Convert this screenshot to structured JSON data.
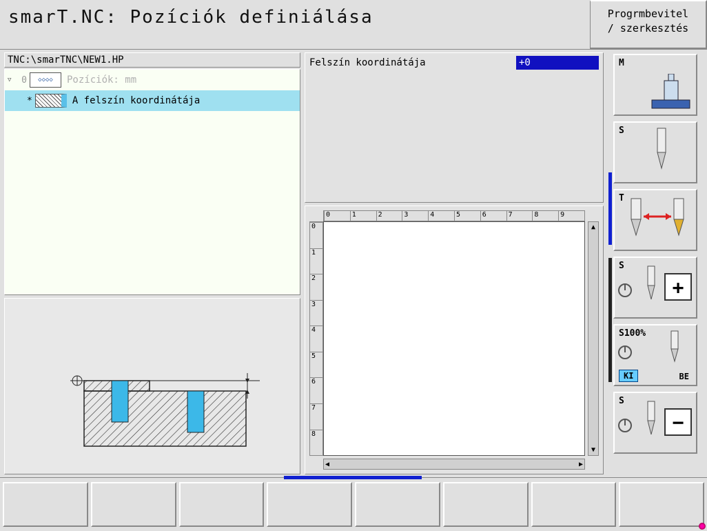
{
  "header": {
    "title": "smarT.NC: Pozíciók definiálása",
    "mode_line1": "Progrmbevitel",
    "mode_line2": "/ szerkesztés"
  },
  "path": "TNC:\\smarTNC\\NEW1.HP",
  "tree": {
    "root_index": "0",
    "root_label": "Pozíciók: mm",
    "item_marker": "*",
    "item_label": "A felszín koordinátája"
  },
  "param": {
    "label": "Felszín koordinátája",
    "value": "+0"
  },
  "ruler_h": [
    "0",
    "1",
    "2",
    "3",
    "4",
    "5",
    "6",
    "7",
    "8",
    "9"
  ],
  "ruler_v": [
    "0",
    "1",
    "2",
    "3",
    "4",
    "5",
    "6",
    "7",
    "8"
  ],
  "side_buttons": {
    "b1": "M",
    "b2": "S",
    "b3": "T",
    "b4": "S",
    "b5_top": "S100%",
    "b5_ki": "KI",
    "b5_be": "BE",
    "b6": "S"
  }
}
